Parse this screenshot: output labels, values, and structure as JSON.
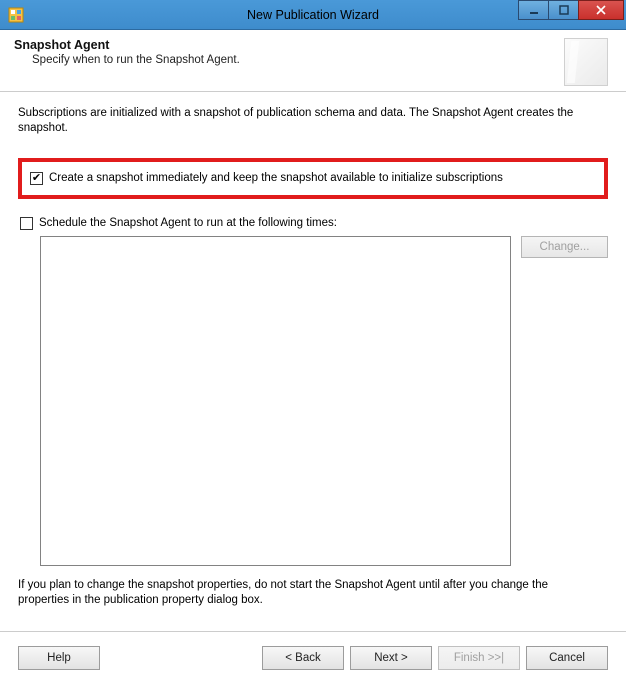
{
  "window": {
    "title": "New Publication Wizard"
  },
  "header": {
    "title": "Snapshot Agent",
    "subtitle": "Specify when to run the Snapshot Agent."
  },
  "body": {
    "intro": "Subscriptions are initialized with a snapshot of publication schema and data. The Snapshot Agent creates the snapshot.",
    "check_immediate": {
      "checked": true,
      "label": "Create a snapshot immediately and keep the snapshot available to initialize subscriptions"
    },
    "check_schedule": {
      "checked": false,
      "label": "Schedule the Snapshot Agent to run at the following times:"
    },
    "change_button": "Change...",
    "note": "If you plan to change the snapshot properties, do not start the Snapshot Agent until after you change the properties in the publication property dialog box."
  },
  "footer": {
    "help": "Help",
    "back": "< Back",
    "next": "Next >",
    "finish": "Finish >>|",
    "cancel": "Cancel"
  }
}
